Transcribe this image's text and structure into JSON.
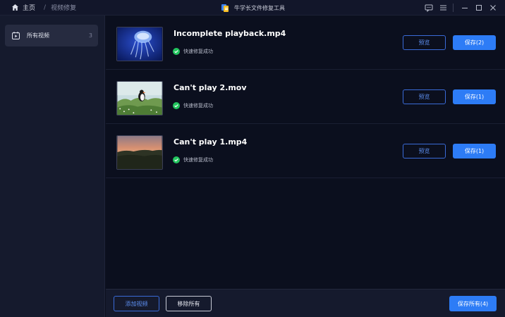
{
  "header": {
    "home_label": "主页",
    "separator": "/",
    "current_label": "视频修复",
    "app_title": "牛学长文件修复工具",
    "home_icon": "home-icon",
    "app_logo": "app-logo-icon",
    "controls": [
      "feedback-icon",
      "menu-icon",
      "minimize-icon",
      "maximize-icon",
      "close-icon"
    ]
  },
  "sidebar": {
    "items": [
      {
        "label": "所有视频",
        "count": "3",
        "icon": "video-calendar-icon"
      }
    ]
  },
  "files": [
    {
      "name": "Incomplete playback.mp4",
      "status": "快速修复成功",
      "preview_label": "预览",
      "save_label": "保存(2)",
      "thumb": "jellyfish"
    },
    {
      "name": "Can't play 2.mov",
      "status": "快速修复成功",
      "preview_label": "预览",
      "save_label": "保存(1)",
      "thumb": "puffin"
    },
    {
      "name": "Can't play 1.mp4",
      "status": "快速修复成功",
      "preview_label": "预览",
      "save_label": "保存(1)",
      "thumb": "sunset"
    }
  ],
  "footer": {
    "add_label": "添加视频",
    "remove_label": "移除所有",
    "save_all_label": "保存所有(4)"
  },
  "colors": {
    "accent": "#2d7cf6",
    "success": "#22c55e",
    "background": "#0b0f1e",
    "sidebar": "#151a2d"
  }
}
